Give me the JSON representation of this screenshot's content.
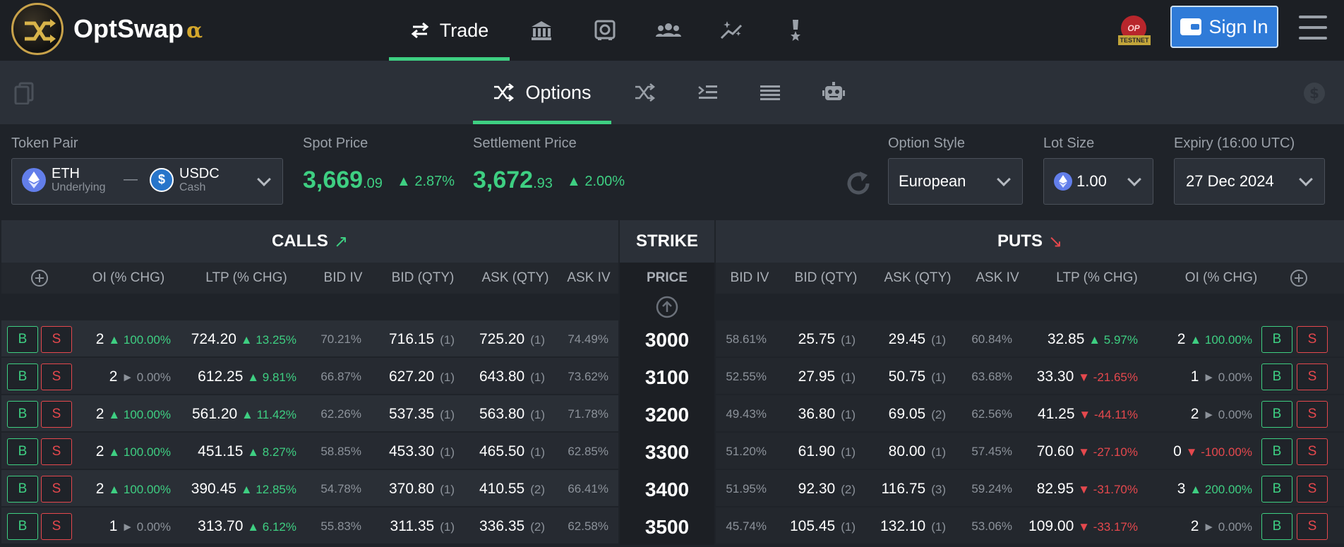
{
  "brand": {
    "name": "OptSwap",
    "suffix": "α"
  },
  "topnav": {
    "trade_label": "Trade"
  },
  "network": {
    "chain": "OP",
    "tag": "TESTNET"
  },
  "auth": {
    "signin_label": "Sign In"
  },
  "subnav": {
    "options_label": "Options"
  },
  "controls": {
    "token_pair_label": "Token Pair",
    "underlying": {
      "symbol": "ETH",
      "role": "Underlying"
    },
    "separator": "—",
    "cash": {
      "symbol": "USDC",
      "role": "Cash"
    },
    "spot": {
      "label": "Spot Price",
      "int": "3,669",
      "dec": ".09",
      "change": "▲ 2.87%"
    },
    "settlement": {
      "label": "Settlement Price",
      "int": "3,672",
      "dec": ".93",
      "change": "▲ 2.00%"
    },
    "option_style": {
      "label": "Option Style",
      "value": "European"
    },
    "lot_size": {
      "label": "Lot Size",
      "value": "1.00"
    },
    "expiry": {
      "label": "Expiry (16:00 UTC)",
      "value": "27 Dec 2024"
    }
  },
  "table": {
    "calls_title": "CALLS",
    "calls_arrow": "↗",
    "strike_title": "STRIKE",
    "puts_title": "PUTS",
    "puts_arrow": "↘",
    "call_cols": {
      "oi": "OI (% CHG)",
      "ltp": "LTP (% CHG)",
      "bid_iv": "BID IV",
      "bid": "BID (QTY)",
      "ask": "ASK (QTY)",
      "ask_iv": "ASK IV"
    },
    "strike_col": "PRICE",
    "put_cols": {
      "bid_iv": "BID IV",
      "bid": "BID (QTY)",
      "ask": "ASK (QTY)",
      "ask_iv": "ASK IV",
      "ltp": "LTP (% CHG)",
      "oi": "OI (% CHG)"
    },
    "buy_label": "B",
    "sell_label": "S",
    "rows": [
      {
        "strike": "3000",
        "c_oi": "2",
        "c_oi_chg": "▲ 100.00%",
        "c_oi_dir": "up",
        "c_ltp": "724.20",
        "c_ltp_chg": "▲ 13.25%",
        "c_ltp_dir": "up",
        "c_bid_iv": "70.21%",
        "c_bid": "716.15",
        "c_bid_qty": "(1)",
        "c_ask": "725.20",
        "c_ask_qty": "(1)",
        "c_ask_iv": "74.49%",
        "p_bid_iv": "58.61%",
        "p_bid": "25.75",
        "p_bid_qty": "(1)",
        "p_ask": "29.45",
        "p_ask_qty": "(1)",
        "p_ask_iv": "60.84%",
        "p_ltp": "32.85",
        "p_ltp_chg": "▲ 5.97%",
        "p_ltp_dir": "up",
        "p_oi": "2",
        "p_oi_chg": "▲ 100.00%",
        "p_oi_dir": "up"
      },
      {
        "strike": "3100",
        "c_oi": "2",
        "c_oi_chg": "► 0.00%",
        "c_oi_dir": "flat",
        "c_ltp": "612.25",
        "c_ltp_chg": "▲ 9.81%",
        "c_ltp_dir": "up",
        "c_bid_iv": "66.87%",
        "c_bid": "627.20",
        "c_bid_qty": "(1)",
        "c_ask": "643.80",
        "c_ask_qty": "(1)",
        "c_ask_iv": "73.62%",
        "p_bid_iv": "52.55%",
        "p_bid": "27.95",
        "p_bid_qty": "(1)",
        "p_ask": "50.75",
        "p_ask_qty": "(1)",
        "p_ask_iv": "63.68%",
        "p_ltp": "33.30",
        "p_ltp_chg": "▼ -21.65%",
        "p_ltp_dir": "dn",
        "p_oi": "1",
        "p_oi_chg": "► 0.00%",
        "p_oi_dir": "flat"
      },
      {
        "strike": "3200",
        "c_oi": "2",
        "c_oi_chg": "▲ 100.00%",
        "c_oi_dir": "up",
        "c_ltp": "561.20",
        "c_ltp_chg": "▲ 11.42%",
        "c_ltp_dir": "up",
        "c_bid_iv": "62.26%",
        "c_bid": "537.35",
        "c_bid_qty": "(1)",
        "c_ask": "563.80",
        "c_ask_qty": "(1)",
        "c_ask_iv": "71.78%",
        "p_bid_iv": "49.43%",
        "p_bid": "36.80",
        "p_bid_qty": "(1)",
        "p_ask": "69.05",
        "p_ask_qty": "(2)",
        "p_ask_iv": "62.56%",
        "p_ltp": "41.25",
        "p_ltp_chg": "▼ -44.11%",
        "p_ltp_dir": "dn",
        "p_oi": "2",
        "p_oi_chg": "► 0.00%",
        "p_oi_dir": "flat"
      },
      {
        "strike": "3300",
        "c_oi": "2",
        "c_oi_chg": "▲ 100.00%",
        "c_oi_dir": "up",
        "c_ltp": "451.15",
        "c_ltp_chg": "▲ 8.27%",
        "c_ltp_dir": "up",
        "c_bid_iv": "58.85%",
        "c_bid": "453.30",
        "c_bid_qty": "(1)",
        "c_ask": "465.50",
        "c_ask_qty": "(1)",
        "c_ask_iv": "62.85%",
        "p_bid_iv": "51.20%",
        "p_bid": "61.90",
        "p_bid_qty": "(1)",
        "p_ask": "80.00",
        "p_ask_qty": "(1)",
        "p_ask_iv": "57.45%",
        "p_ltp": "70.60",
        "p_ltp_chg": "▼ -27.10%",
        "p_ltp_dir": "dn",
        "p_oi": "0",
        "p_oi_chg": "▼ -100.00%",
        "p_oi_dir": "dn"
      },
      {
        "strike": "3400",
        "c_oi": "2",
        "c_oi_chg": "▲ 100.00%",
        "c_oi_dir": "up",
        "c_ltp": "390.45",
        "c_ltp_chg": "▲ 12.85%",
        "c_ltp_dir": "up",
        "c_bid_iv": "54.78%",
        "c_bid": "370.80",
        "c_bid_qty": "(1)",
        "c_ask": "410.55",
        "c_ask_qty": "(2)",
        "c_ask_iv": "66.41%",
        "p_bid_iv": "51.95%",
        "p_bid": "92.30",
        "p_bid_qty": "(2)",
        "p_ask": "116.75",
        "p_ask_qty": "(3)",
        "p_ask_iv": "59.24%",
        "p_ltp": "82.95",
        "p_ltp_chg": "▼ -31.70%",
        "p_ltp_dir": "dn",
        "p_oi": "3",
        "p_oi_chg": "▲ 200.00%",
        "p_oi_dir": "up"
      },
      {
        "strike": "3500",
        "c_oi": "1",
        "c_oi_chg": "► 0.00%",
        "c_oi_dir": "flat",
        "c_ltp": "313.70",
        "c_ltp_chg": "▲ 6.12%",
        "c_ltp_dir": "up",
        "c_bid_iv": "55.83%",
        "c_bid": "311.35",
        "c_bid_qty": "(1)",
        "c_ask": "336.35",
        "c_ask_qty": "(2)",
        "c_ask_iv": "62.58%",
        "p_bid_iv": "45.74%",
        "p_bid": "105.45",
        "p_bid_qty": "(1)",
        "p_ask": "132.10",
        "p_ask_qty": "(1)",
        "p_ask_iv": "53.06%",
        "p_ltp": "109.00",
        "p_ltp_chg": "▼ -33.17%",
        "p_ltp_dir": "dn",
        "p_oi": "2",
        "p_oi_chg": "► 0.00%",
        "p_oi_dir": "flat"
      }
    ]
  },
  "colors": {
    "accent_green": "#3ecf82",
    "accent_red": "#e5484d",
    "primary_blue": "#2f7bd8",
    "brand_gold": "#c8a24a"
  }
}
